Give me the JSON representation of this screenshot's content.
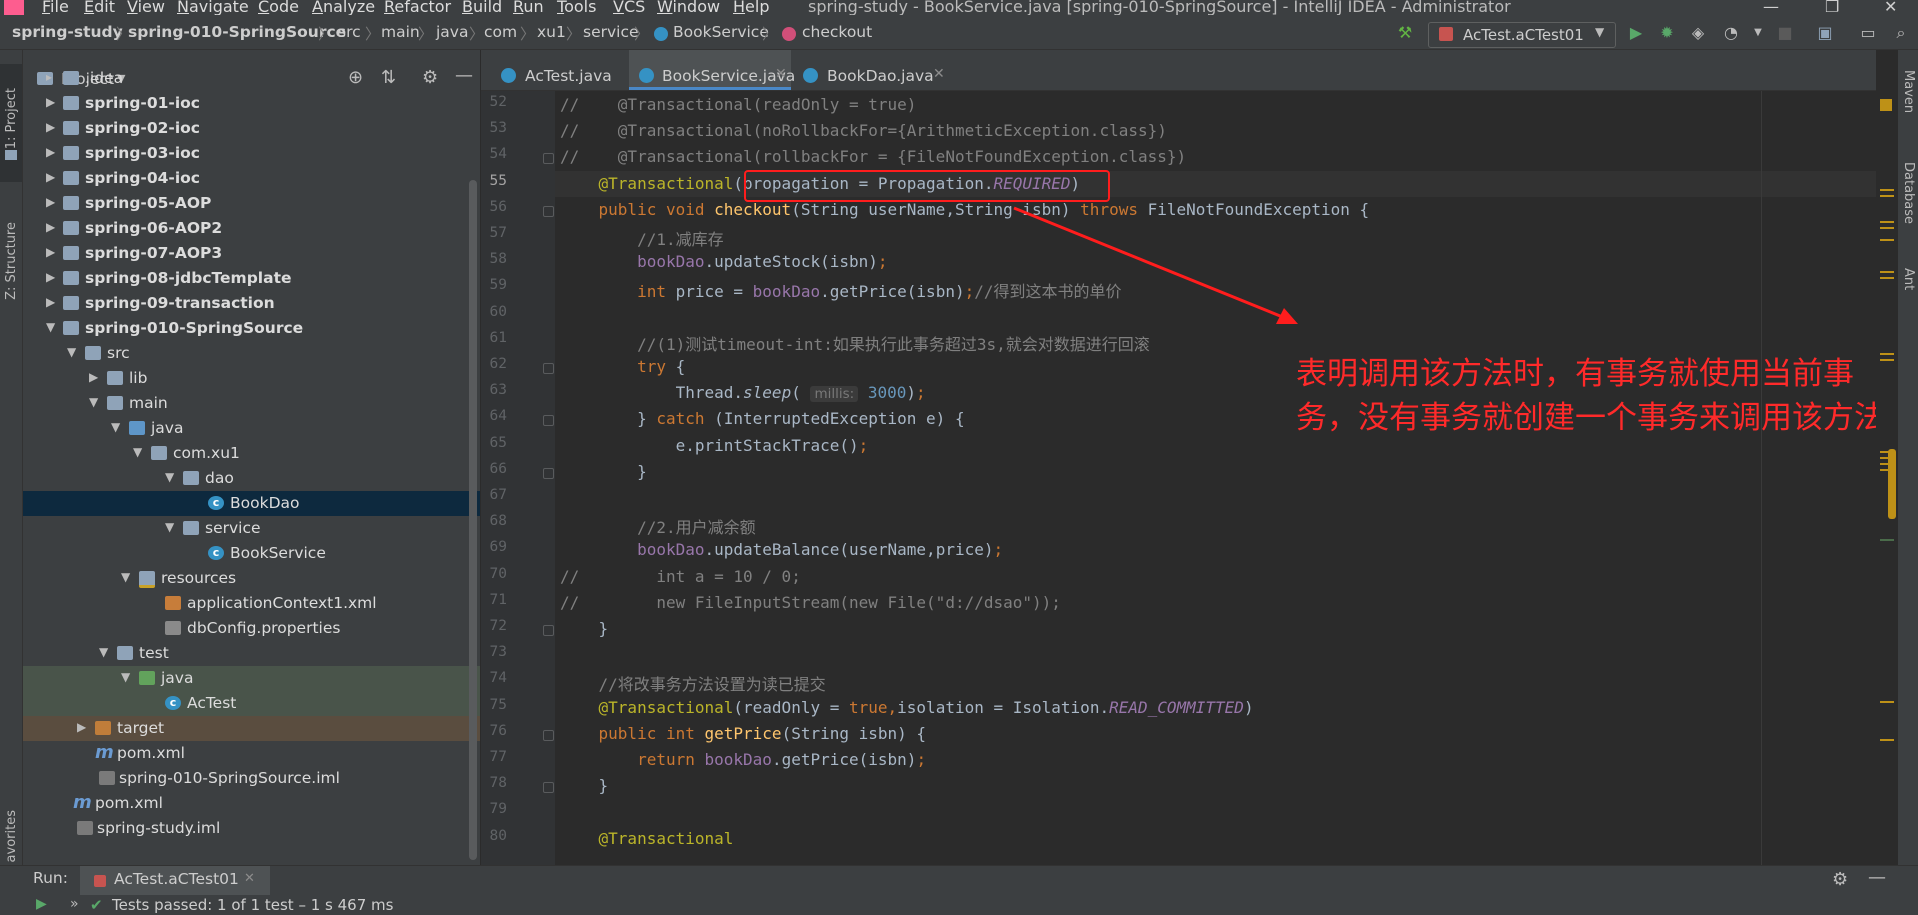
{
  "menu": {
    "items": [
      "File",
      "Edit",
      "View",
      "Navigate",
      "Code",
      "Analyze",
      "Refactor",
      "Build",
      "Run",
      "Tools",
      "VCS",
      "Window",
      "Help"
    ],
    "window_title": "spring-study - BookService.java [spring-010-SpringSource] - IntelliJ IDEA - Administrator"
  },
  "breadcrumbs": [
    "spring-study",
    "spring-010-SpringSource",
    "src",
    "main",
    "java",
    "com",
    "xu1",
    "service",
    "BookService",
    "checkout"
  ],
  "toolbar": {
    "run_config": "AcTest.aCTest01"
  },
  "left_strip": {
    "project_tab": "1: Project",
    "structure_tab": "Z: Structure",
    "favorites_tab": "avorites"
  },
  "right_strip": {
    "maven_tab": "Maven",
    "database_tab": "Database",
    "ant_tab": "Ant"
  },
  "project": {
    "title": "Project",
    "tree": [
      {
        "label": ".idea",
        "bold": false
      },
      {
        "label": "spring-01-ioc",
        "bold": true
      },
      {
        "label": "spring-02-ioc",
        "bold": true
      },
      {
        "label": "spring-03-ioc",
        "bold": true
      },
      {
        "label": "spring-04-ioc",
        "bold": true
      },
      {
        "label": "spring-05-AOP",
        "bold": true
      },
      {
        "label": "spring-06-AOP2",
        "bold": true
      },
      {
        "label": "spring-07-AOP3",
        "bold": true
      },
      {
        "label": "spring-08-jdbcTemplate",
        "bold": true
      },
      {
        "label": "spring-09-transaction",
        "bold": true
      },
      {
        "label": "spring-010-SpringSource",
        "bold": true
      },
      {
        "label": "src",
        "bold": false
      },
      {
        "label": "lib",
        "bold": false
      },
      {
        "label": "main",
        "bold": false
      },
      {
        "label": "java",
        "bold": false
      },
      {
        "label": "com.xu1",
        "bold": false
      },
      {
        "label": "dao",
        "bold": false
      },
      {
        "label": "BookDao",
        "bold": false
      },
      {
        "label": "service",
        "bold": false
      },
      {
        "label": "BookService",
        "bold": false
      },
      {
        "label": "resources",
        "bold": false
      },
      {
        "label": "applicationContext1.xml",
        "bold": false
      },
      {
        "label": "dbConfig.properties",
        "bold": false
      },
      {
        "label": "test",
        "bold": false
      },
      {
        "label": "java",
        "bold": false
      },
      {
        "label": "AcTest",
        "bold": false
      },
      {
        "label": "target",
        "bold": false
      },
      {
        "label": "pom.xml",
        "bold": false
      },
      {
        "label": "spring-010-SpringSource.iml",
        "bold": false
      },
      {
        "label": "pom.xml",
        "bold": false
      },
      {
        "label": "spring-study.iml",
        "bold": false
      }
    ]
  },
  "editor": {
    "tabs": [
      "AcTest.java",
      "BookService.java",
      "BookDao.java"
    ],
    "active_tab": "BookService.java",
    "current_line": "55",
    "lines": [
      {
        "no": "52",
        "segs": [
          [
            "cm",
            "//    @Transactional(readOnly = true)"
          ]
        ]
      },
      {
        "no": "53",
        "segs": [
          [
            "cm",
            "//    @Transactional(noRollbackFor={ArithmeticException.class})"
          ]
        ]
      },
      {
        "no": "54",
        "segs": [
          [
            "cm",
            "//    @Transactional(rollbackFor = {FileNotFoundException.class})"
          ]
        ]
      },
      {
        "no": "55",
        "segs": [
          [
            "",
            "    "
          ],
          [
            "an",
            "@Transactional"
          ],
          [
            "",
            "(propagation = Propagation."
          ],
          [
            "fldi",
            "REQUIRED"
          ],
          [
            "",
            ")"
          ]
        ]
      },
      {
        "no": "56",
        "segs": [
          [
            "",
            "    "
          ],
          [
            "kw",
            "public void "
          ],
          [
            "mt",
            "checkout"
          ],
          [
            "",
            "(String userName,String isbn) "
          ],
          [
            "kw",
            "throws "
          ],
          [
            "",
            "FileNotFoundException {"
          ]
        ]
      },
      {
        "no": "57",
        "segs": [
          [
            "cm",
            "        //1.减库存"
          ]
        ]
      },
      {
        "no": "58",
        "segs": [
          [
            "",
            "        "
          ],
          [
            "fld",
            "bookDao"
          ],
          [
            "",
            ".updateStock(isbn)"
          ],
          [
            "kw",
            ";"
          ]
        ]
      },
      {
        "no": "59",
        "segs": [
          [
            "",
            "        "
          ],
          [
            "kw",
            "int "
          ],
          [
            "",
            "price = "
          ],
          [
            "fld",
            "bookDao"
          ],
          [
            "",
            ".getPrice(isbn)"
          ],
          [
            "kw",
            ";"
          ],
          [
            "cm",
            "//得到这本书的单价"
          ]
        ]
      },
      {
        "no": "60",
        "segs": []
      },
      {
        "no": "61",
        "segs": [
          [
            "cm",
            "        //(1)测试timeout-int:如果执行此事务超过3s,就会对数据进行回滚"
          ]
        ]
      },
      {
        "no": "62",
        "segs": [
          [
            "",
            "        "
          ],
          [
            "kw",
            "try "
          ],
          [
            "",
            "{"
          ]
        ]
      },
      {
        "no": "63",
        "segs": [
          [
            "",
            "            Thread."
          ],
          [
            "it",
            "sleep"
          ],
          [
            "",
            "( "
          ],
          [
            "hint",
            "millis:"
          ],
          [
            "nm",
            " 3000"
          ],
          [
            "",
            ")"
          ],
          [
            "kw",
            ";"
          ]
        ]
      },
      {
        "no": "64",
        "segs": [
          [
            "",
            "        } "
          ],
          [
            "kw",
            "catch "
          ],
          [
            "",
            "(InterruptedException e) {"
          ]
        ]
      },
      {
        "no": "65",
        "segs": [
          [
            "",
            "            e.printStackTrace()"
          ],
          [
            "kw",
            ";"
          ]
        ]
      },
      {
        "no": "66",
        "segs": [
          [
            "",
            "        }"
          ]
        ]
      },
      {
        "no": "67",
        "segs": []
      },
      {
        "no": "68",
        "segs": [
          [
            "cm",
            "        //2.用户减余额"
          ]
        ]
      },
      {
        "no": "69",
        "segs": [
          [
            "",
            "        "
          ],
          [
            "fld",
            "bookDao"
          ],
          [
            "",
            ".updateBalance(userName,price)"
          ],
          [
            "kw",
            ";"
          ]
        ]
      },
      {
        "no": "70",
        "segs": [
          [
            "cm",
            "//        int a = 10 / 0;"
          ]
        ]
      },
      {
        "no": "71",
        "segs": [
          [
            "cm",
            "//        new FileInputStream(new File(\"d://dsao\"));"
          ]
        ]
      },
      {
        "no": "72",
        "segs": [
          [
            "",
            "    }"
          ]
        ]
      },
      {
        "no": "73",
        "segs": []
      },
      {
        "no": "74",
        "segs": [
          [
            "cm",
            "    //将改事务方法设置为读已提交"
          ]
        ]
      },
      {
        "no": "75",
        "segs": [
          [
            "",
            "    "
          ],
          [
            "an",
            "@Transactional"
          ],
          [
            "",
            "(readOnly = "
          ],
          [
            "kw",
            "true,"
          ],
          [
            "",
            "isolation = Isolation."
          ],
          [
            "fldi",
            "READ_COMMITTED"
          ],
          [
            "",
            ")"
          ]
        ]
      },
      {
        "no": "76",
        "segs": [
          [
            "",
            "    "
          ],
          [
            "kw",
            "public int "
          ],
          [
            "mt",
            "getPrice"
          ],
          [
            "",
            "(String isbn) {"
          ]
        ]
      },
      {
        "no": "77",
        "segs": [
          [
            "",
            "        "
          ],
          [
            "kw",
            "return "
          ],
          [
            "fld",
            "bookDao"
          ],
          [
            "",
            ".getPrice(isbn)"
          ],
          [
            "kw",
            ";"
          ]
        ]
      },
      {
        "no": "78",
        "segs": [
          [
            "",
            "    }"
          ]
        ]
      },
      {
        "no": "79",
        "segs": []
      },
      {
        "no": "80",
        "segs": [
          [
            "",
            "    "
          ],
          [
            "an",
            "@Transactional"
          ]
        ]
      }
    ]
  },
  "annotation": {
    "text": "表明调用该方法时，有事务就使用当前事务，没有事务就创建一个事务来调用该方法",
    "color": "#ff2a2a"
  },
  "run_panel": {
    "label": "Run:",
    "tab": "AcTest.aCTest01",
    "status": "Tests passed: 1 of 1 test – 1 s 467 ms"
  },
  "colors": {
    "editor_bg": "#2b2b2b",
    "panel_bg": "#3c3f41",
    "keyword": "#cc7832",
    "annotation": "#bbb529",
    "comment": "#808080",
    "field": "#9876aa",
    "number": "#6897bb",
    "selection": "#0d293e"
  }
}
